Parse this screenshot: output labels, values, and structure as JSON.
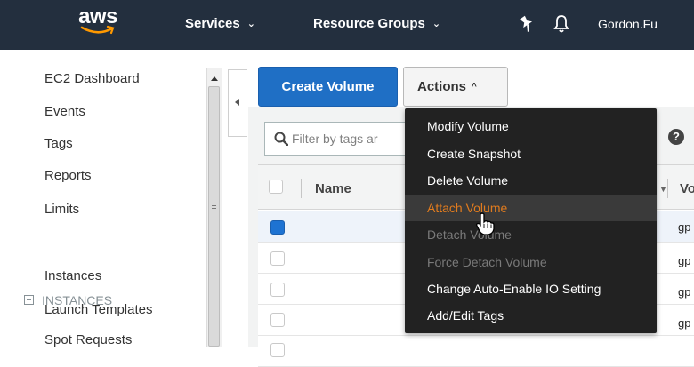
{
  "header": {
    "logo_text": "aws",
    "services_label": "Services",
    "resource_groups_label": "Resource Groups",
    "user_label": "Gordon.Fu",
    "caret": "⌄"
  },
  "sidebar": {
    "items": [
      {
        "label": "EC2 Dashboard"
      },
      {
        "label": "Events"
      },
      {
        "label": "Tags"
      },
      {
        "label": "Reports"
      },
      {
        "label": "Limits"
      }
    ],
    "section_label": "INSTANCES",
    "section_items": [
      {
        "label": "Instances"
      },
      {
        "label": "Launch Templates"
      },
      {
        "label": "Spot Requests"
      }
    ]
  },
  "toolbar": {
    "create_label": "Create Volume",
    "actions_label": "Actions",
    "actions_caret": "^"
  },
  "filter": {
    "placeholder": "Filter by tags ar",
    "help_label": "?"
  },
  "table": {
    "columns": [
      "Name",
      "Vo"
    ],
    "rows": [
      {
        "type": "gp",
        "checked": true
      },
      {
        "type": "gp",
        "checked": false
      },
      {
        "type": "gp",
        "checked": false
      },
      {
        "type": "gp",
        "checked": false
      }
    ]
  },
  "actions_menu": {
    "items": [
      {
        "label": "Modify Volume",
        "state": "normal"
      },
      {
        "label": "Create Snapshot",
        "state": "normal"
      },
      {
        "label": "Delete Volume",
        "state": "normal"
      },
      {
        "label": "Attach Volume",
        "state": "hover"
      },
      {
        "label": "Detach Volume",
        "state": "disabled"
      },
      {
        "label": "Force Detach Volume",
        "state": "disabled"
      },
      {
        "label": "Change Auto-Enable IO Setting",
        "state": "normal"
      },
      {
        "label": "Add/Edit Tags",
        "state": "normal"
      }
    ]
  },
  "colors": {
    "header_bg": "#232f3e",
    "primary_button": "#1f6fc5",
    "menu_bg": "#222222",
    "menu_hover_text": "#e07b1e"
  }
}
